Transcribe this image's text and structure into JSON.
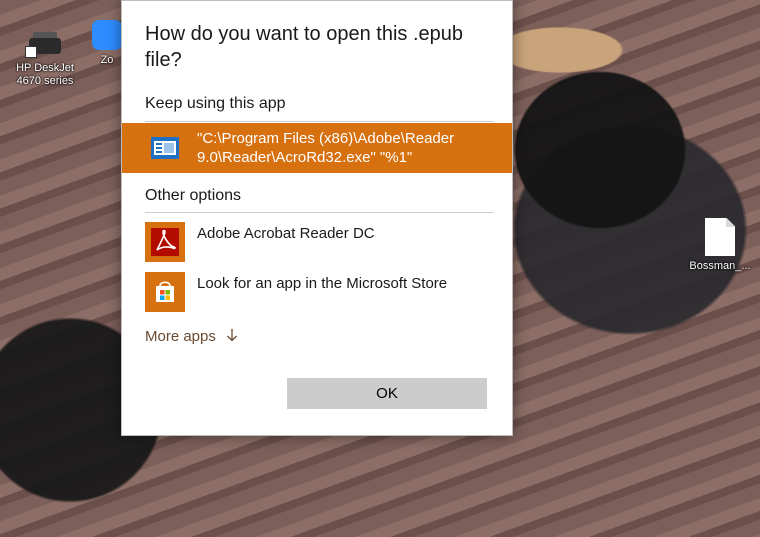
{
  "desktop": {
    "icons": [
      {
        "label": "HP DeskJet 4670 series",
        "icon": "printer-icon"
      },
      {
        "label": "Zo",
        "icon": "zoom-icon"
      },
      {
        "label": "Bossman_...",
        "icon": "file-icon"
      }
    ]
  },
  "dialog": {
    "title": "How do you want to open this .epub file?",
    "keep_heading": "Keep using this app",
    "current_app": {
      "label": "\"C:\\Program Files (x86)\\Adobe\\Reader 9.0\\Reader\\AcroRd32.exe\" \"%1\"",
      "icon": "reader-app-icon"
    },
    "other_heading": "Other options",
    "options": [
      {
        "label": "Adobe Acrobat Reader DC",
        "icon": "acrobat-icon"
      },
      {
        "label": "Look for an app in the Microsoft Store",
        "icon": "store-icon"
      }
    ],
    "more_apps": "More apps",
    "more_apps_icon": "arrow-down-icon",
    "ok_label": "OK"
  },
  "colors": {
    "accent": "#d7710f",
    "acrobat_red": "#b30b00",
    "store_orange": "#d7710f"
  }
}
